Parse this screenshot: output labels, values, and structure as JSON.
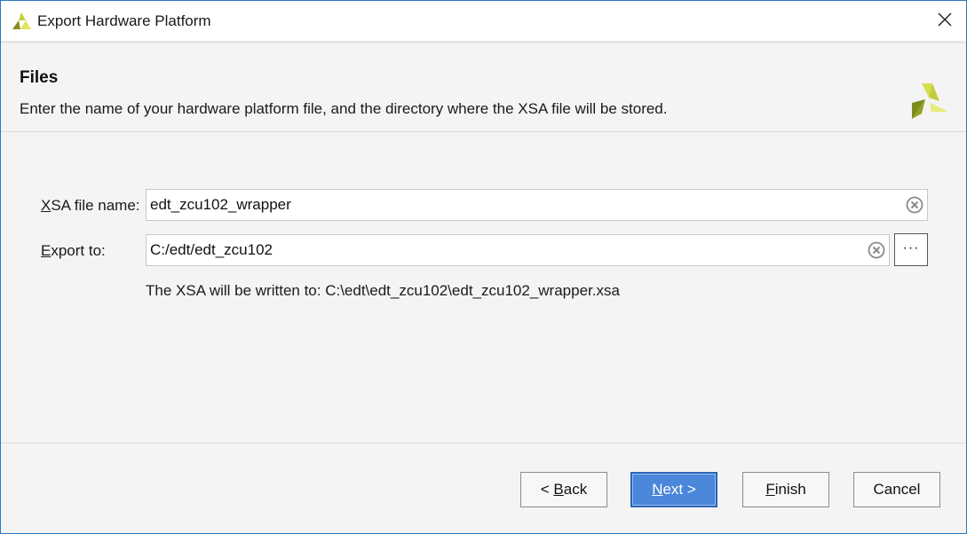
{
  "window": {
    "title": "Export Hardware Platform",
    "accent_color": "#2b78c5",
    "icons": {
      "app": "xilinx-logo-icon",
      "close": "close-icon"
    }
  },
  "header": {
    "heading": "Files",
    "description": "Enter the name of your hardware platform file, and the directory where the XSA file will be stored.",
    "logo_icon": "xilinx-logo-icon"
  },
  "form": {
    "xsa_file_name": {
      "label_mnemonic": "X",
      "label_rest": "SA file name:",
      "value": "edt_zcu102_wrapper",
      "clear_icon": "clear-icon"
    },
    "export_to": {
      "label_mnemonic": "E",
      "label_rest": "xport to:",
      "value": "C:/edt/edt_zcu102",
      "clear_icon": "clear-icon",
      "browse_label": "···"
    },
    "output_note": "The XSA will be written to: C:\\edt\\edt_zcu102\\edt_zcu102_wrapper.xsa"
  },
  "buttons": {
    "back": {
      "prefix": "< ",
      "mnemonic": "B",
      "rest": "ack"
    },
    "next": {
      "mnemonic": "N",
      "rest": "ext >",
      "color": "#4a86d9"
    },
    "finish": {
      "mnemonic": "F",
      "rest": "inish"
    },
    "cancel": {
      "label": "Cancel"
    }
  }
}
